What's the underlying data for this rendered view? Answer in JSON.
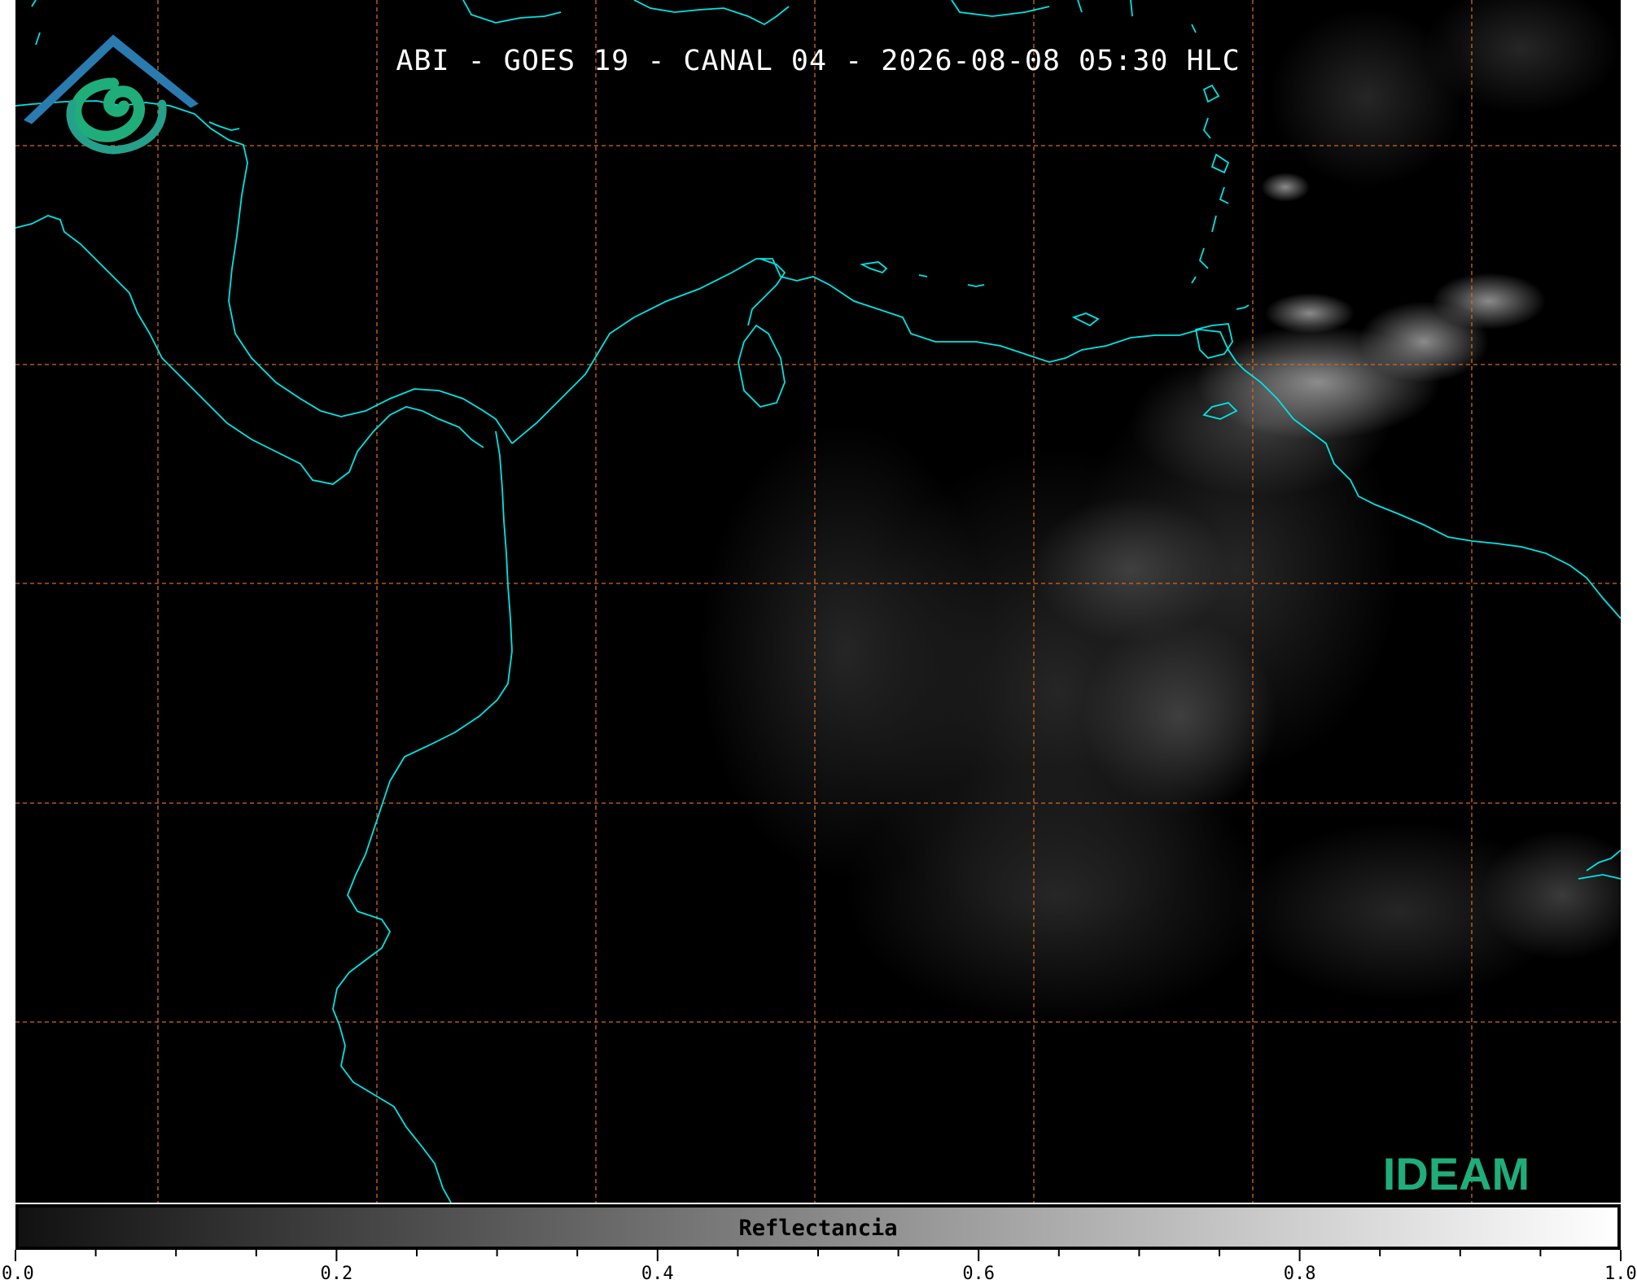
{
  "title": "ABI - GOES 19 - CANAL 04 - 2026-08-08 05:30 HLC",
  "colors": {
    "background": "#000000",
    "coastline": "#00e5e5",
    "gridline": "#d2691e",
    "logo_blue": "#2a6fb8",
    "logo_green": "#1fae7a"
  },
  "logo": {
    "icon": "ideam-logo-icon",
    "text": "IDEAM"
  },
  "colorbar": {
    "label": "Reflectancia",
    "range": [
      0.0,
      1.0
    ],
    "tick_labels": [
      "0.0",
      "0.2",
      "0.4",
      "0.6",
      "0.8",
      "1.0"
    ],
    "tick_values": [
      0.0,
      0.2,
      0.4,
      0.6,
      0.8,
      1.0
    ],
    "minor_step": 0.05,
    "gradient": [
      "#111111",
      "#ffffff"
    ]
  }
}
